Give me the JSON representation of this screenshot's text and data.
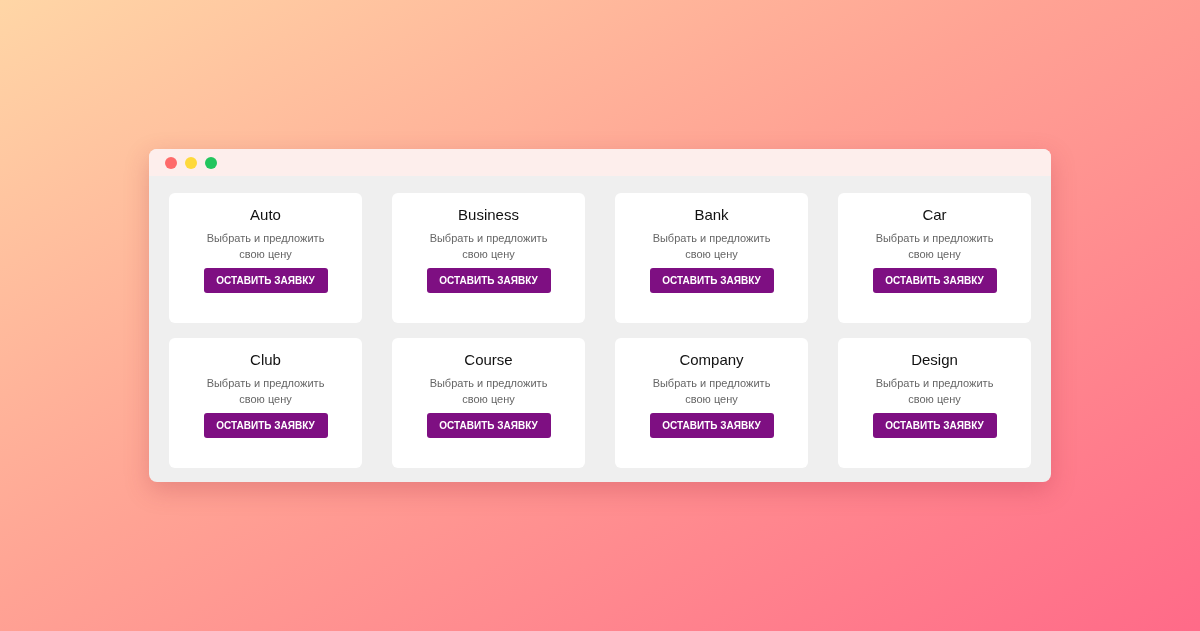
{
  "window": {
    "controls": [
      {
        "color": "#fe6a6a"
      },
      {
        "color": "#fed93b"
      },
      {
        "color": "#22c55e"
      }
    ]
  },
  "cards": [
    {
      "title": "Auto",
      "description": "Выбрать и предложить свою цену",
      "button": "ОСТАВИТЬ ЗАЯВКУ"
    },
    {
      "title": "Business",
      "description": "Выбрать и предложить свою цену",
      "button": "ОСТАВИТЬ ЗАЯВКУ"
    },
    {
      "title": "Bank",
      "description": "Выбрать и предложить свою цену",
      "button": "ОСТАВИТЬ ЗАЯВКУ"
    },
    {
      "title": "Car",
      "description": "Выбрать и предложить свою цену",
      "button": "ОСТАВИТЬ ЗАЯВКУ"
    },
    {
      "title": "Club",
      "description": "Выбрать и предложить свою цену",
      "button": "ОСТАВИТЬ ЗАЯВКУ"
    },
    {
      "title": "Course",
      "description": "Выбрать и предложить свою цену",
      "button": "ОСТАВИТЬ ЗАЯВКУ"
    },
    {
      "title": "Company",
      "description": "Выбрать и предложить свою цену",
      "button": "ОСТАВИТЬ ЗАЯВКУ"
    },
    {
      "title": "Design",
      "description": "Выбрать и предложить свою цену",
      "button": "ОСТАВИТЬ ЗАЯВКУ"
    }
  ]
}
